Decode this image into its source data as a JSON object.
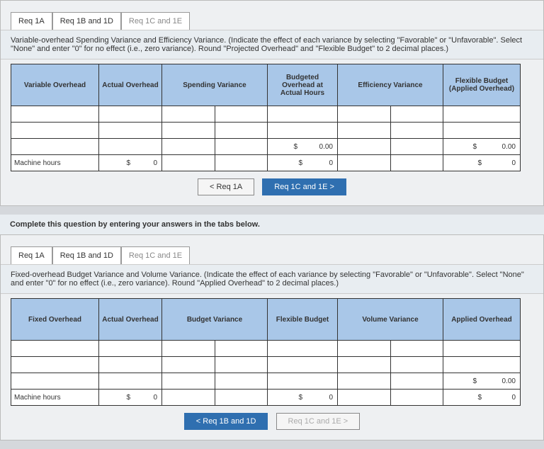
{
  "panel1": {
    "tabs": [
      "Req 1A",
      "Req 1B and 1D",
      "Req 1C and 1E"
    ],
    "instruction": "Variable-overhead Spending Variance and Efficiency Variance. (Indicate the effect of each variance by selecting \"Favorable\" or \"Unfavorable\". Select \"None\" and enter \"0\" for no effect (i.e., zero variance). Round \"Projected Overhead\" and \"Flexible Budget\" to 2 decimal places.)",
    "headers": [
      "Variable Overhead",
      "Actual Overhead",
      "Spending Variance",
      "Budgeted Overhead at Actual Hours",
      "Efficiency Variance",
      "Flexible Budget (Applied Overhead)"
    ],
    "row_value": {
      "h3_cur": "$",
      "h3_val": "0.00",
      "h5_cur": "$",
      "h5_val": "0.00"
    },
    "row_mh_label": "Machine hours",
    "row_mh": {
      "c1_cur": "$",
      "c1_val": "0",
      "c3_cur": "$",
      "c3_val": "0",
      "c5_cur": "$",
      "c5_val": "0"
    },
    "nav_prev": "<  Req 1A",
    "nav_next": "Req 1C and 1E  >"
  },
  "lead": "Complete this question by entering your answers in the tabs below.",
  "panel2": {
    "tabs": [
      "Req 1A",
      "Req 1B and 1D",
      "Req 1C and 1E"
    ],
    "instruction": "Fixed-overhead Budget Variance and Volume Variance. (Indicate the effect of each variance by selecting \"Favorable\" or \"Unfavorable\". Select \"None\" and enter \"0\" for no effect (i.e., zero variance). Round \"Applied Overhead\" to 2 decimal places.)",
    "headers": [
      "Fixed Overhead",
      "Actual Overhead",
      "Budget Variance",
      "Flexible Budget",
      "Volume Variance",
      "Applied Overhead"
    ],
    "row_value": {
      "h5_cur": "$",
      "h5_val": "0.00"
    },
    "row_mh_label": "Machine hours",
    "row_mh": {
      "c1_cur": "$",
      "c1_val": "0",
      "c3_cur": "$",
      "c3_val": "0",
      "c5_cur": "$",
      "c5_val": "0"
    },
    "nav_prev": "<  Req 1B and 1D",
    "nav_next": "Req 1C and 1E  >"
  }
}
